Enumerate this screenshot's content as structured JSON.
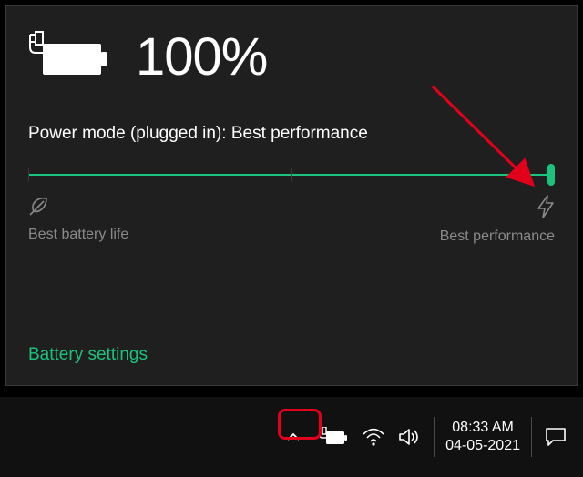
{
  "battery": {
    "percent_text": "100%"
  },
  "power_mode": {
    "label": "Power mode (plugged in): Best performance"
  },
  "slider": {
    "left_label": "Best battery life",
    "right_label": "Best performance",
    "thumb_position_percent": 100
  },
  "link": {
    "battery_settings": "Battery settings"
  },
  "taskbar": {
    "time": "08:33 AM",
    "date": "04-05-2021"
  },
  "colors": {
    "accent": "#1bc47d"
  }
}
